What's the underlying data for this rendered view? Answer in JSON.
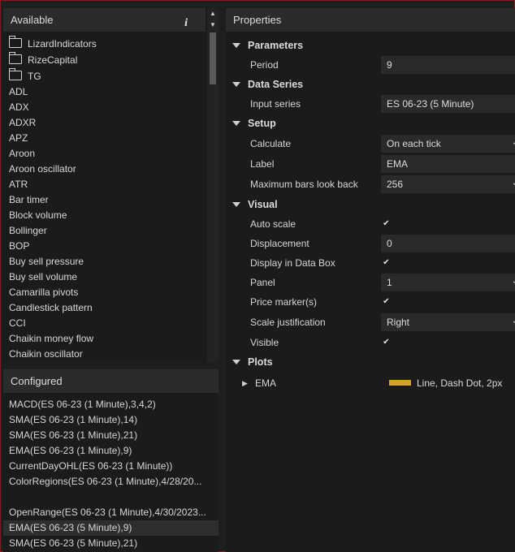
{
  "available": {
    "title": "Available",
    "info_icon": "i",
    "folders": [
      "LizardIndicators",
      "RizeCapital",
      "TG"
    ],
    "items": [
      "ADL",
      "ADX",
      "ADXR",
      "APZ",
      "Aroon",
      "Aroon oscillator",
      "ATR",
      "Bar timer",
      "Block volume",
      "Bollinger",
      "BOP",
      "Buy sell pressure",
      "Buy sell volume",
      "Camarilla pivots",
      "Candlestick pattern",
      "CCI",
      "Chaikin money flow",
      "Chaikin oscillator"
    ]
  },
  "configured": {
    "title": "Configured",
    "items": [
      "MACD(ES 06-23 (1 Minute),3,4,2)",
      "SMA(ES 06-23 (1 Minute),14)",
      "SMA(ES 06-23 (1 Minute),21)",
      "EMA(ES 06-23 (1 Minute),9)",
      "CurrentDayOHL(ES 06-23 (1 Minute))",
      "ColorRegions(ES 06-23 (1 Minute),4/28/20...",
      "",
      "OpenRange(ES 06-23 (1 Minute),4/30/2023...",
      "EMA(ES 06-23 (5 Minute),9)",
      "SMA(ES 06-23 (5 Minute),21)"
    ],
    "selected_index": 8
  },
  "properties": {
    "title": "Properties",
    "parameters": {
      "label": "Parameters",
      "period_label": "Period",
      "period_value": "9"
    },
    "data_series": {
      "label": "Data Series",
      "input_label": "Input series",
      "input_value": "ES 06-23 (5 Minute)"
    },
    "setup": {
      "label": "Setup",
      "calculate_label": "Calculate",
      "calculate_value": "On each tick",
      "label_label": "Label",
      "label_value": "EMA",
      "maxbars_label": "Maximum bars look back",
      "maxbars_value": "256"
    },
    "visual": {
      "label": "Visual",
      "autoscale_label": "Auto scale",
      "displacement_label": "Displacement",
      "displacement_value": "0",
      "databox_label": "Display in Data Box",
      "panel_label": "Panel",
      "panel_value": "1",
      "pricemarker_label": "Price marker(s)",
      "scalejust_label": "Scale justification",
      "scalejust_value": "Right",
      "visible_label": "Visible",
      "checkmark": "✔"
    },
    "plots": {
      "label": "Plots",
      "plot_name": "EMA",
      "plot_desc": "Line, Dash Dot, 2px",
      "plot_color": "#d4a42a"
    }
  }
}
